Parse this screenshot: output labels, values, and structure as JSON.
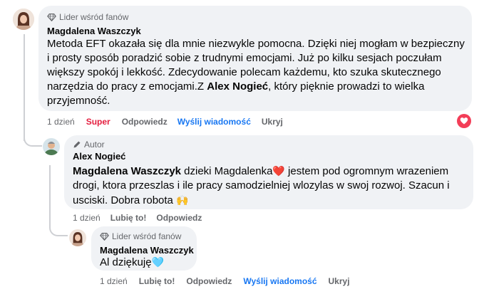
{
  "comments": [
    {
      "badge": "Lider wśród fanów",
      "author": "Magdalena Waszczyk",
      "text_part1": "Metoda EFT okazała się dla mnie niezwykle pomocna. Dzięki niej mogłam w bezpieczny i prosty sposób poradzić sobie z trudnymi emocjami. Już po kilku sesjach poczułam większy spokój i lekkość. Zdecydowanie polecam każdemu, kto szuka skutecznego narzędzia do pracy z emocjami.Z ",
      "mention": "Alex Nogieć",
      "text_part2": ", który pięknie prowadzi to wielka przyjemność.",
      "time": "1 dzień",
      "reaction": "Super",
      "reply": "Odpowiedz",
      "message": "Wyślij wiadomość",
      "hide": "Ukryj",
      "reaction_icon": "heart-icon"
    },
    {
      "badge": "Autor",
      "author": "Alex Nogieć",
      "mention": "Magdalena Waszczyk",
      "text_part1": " dzieki Magdalenka",
      "emoji1": "❤️",
      "text_part2": " jestem pod ogromnym wrazeniem drogi, ktora przeszlas i ile pracy samodzielniej wlozylas w swoj rozwoj. Szacun i usciski. Dobra robota ",
      "emoji2": "🙌",
      "time": "1 dzień",
      "like": "Lubię to!",
      "reply": "Odpowiedz"
    },
    {
      "badge": "Lider wśród fanów",
      "author": "Magdalena Waszczyk",
      "text": "Al dziękuję",
      "emoji": "🩵",
      "time": "1 dzień",
      "like": "Lubię to!",
      "reply": "Odpowiedz",
      "message": "Wyślij wiadomość",
      "hide": "Ukryj"
    }
  ]
}
